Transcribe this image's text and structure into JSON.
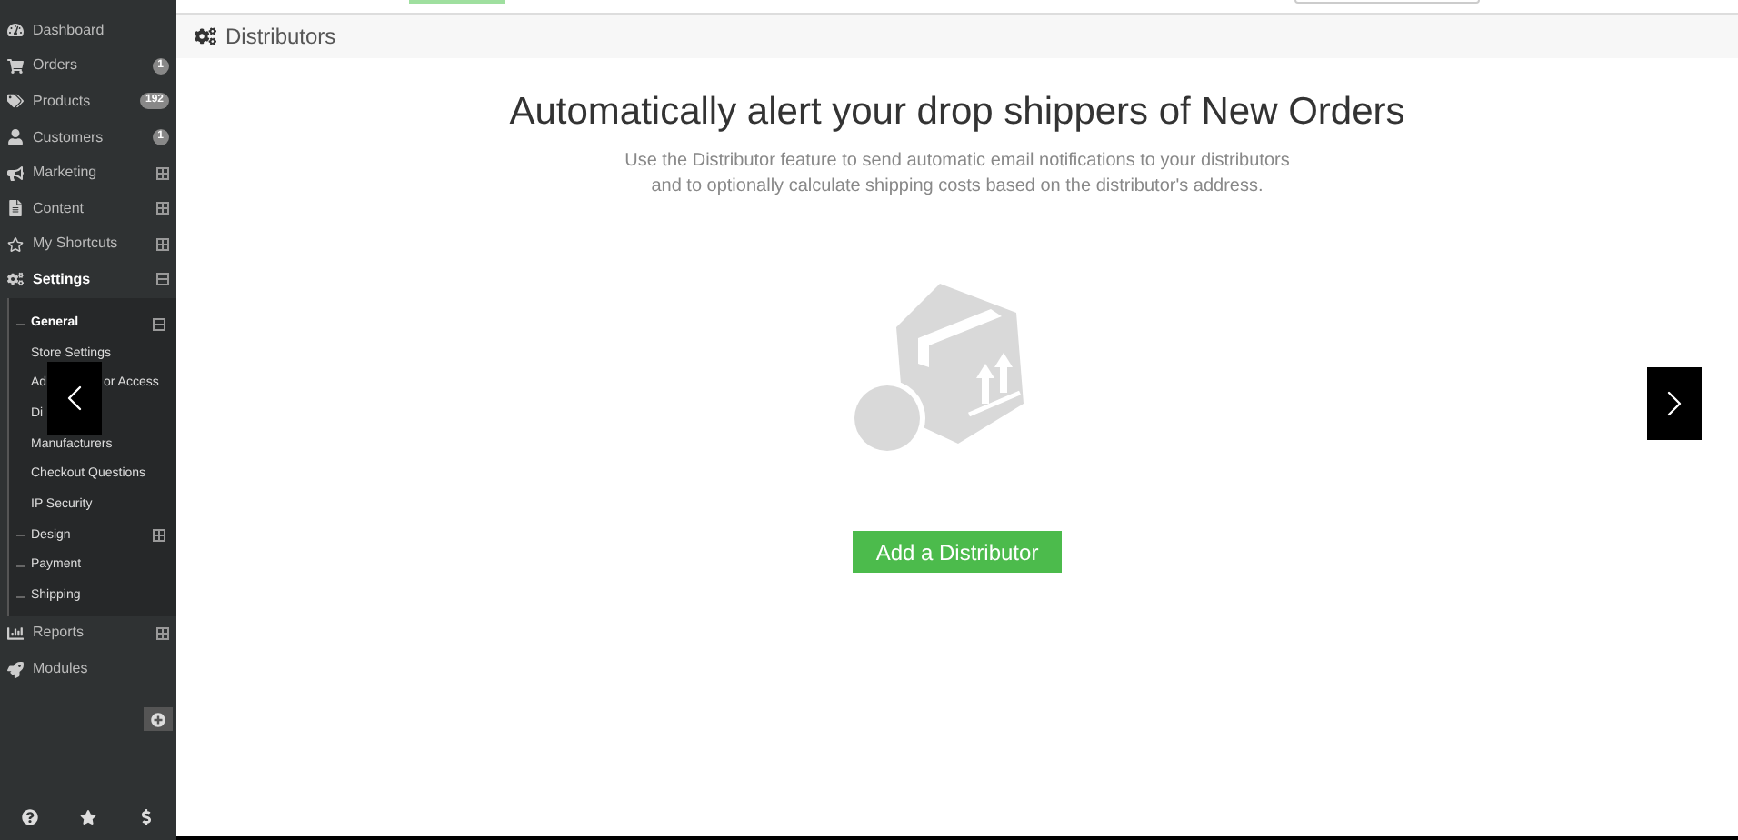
{
  "sidebar": {
    "items": [
      {
        "label": "Dashboard",
        "selected": false
      },
      {
        "label": "Orders",
        "badge": "1",
        "selected": false
      },
      {
        "label": "Products",
        "badge": "192",
        "selected": false
      },
      {
        "label": "Customers",
        "badge": "1",
        "selected": false
      },
      {
        "label": "Marketing",
        "expanded": false,
        "selected": false
      },
      {
        "label": "Content",
        "expanded": false,
        "selected": false
      },
      {
        "label": "My Shortcuts",
        "expanded": false,
        "selected": false
      },
      {
        "label": "Settings",
        "expanded": true,
        "selected": true,
        "children": [
          {
            "kind": "group",
            "label": "General",
            "expanded": true,
            "children": [
              {
                "kind": "link",
                "label": "Store Settings"
              },
              {
                "kind": "link",
                "label": "Ad",
                "label_end": "or Access"
              },
              {
                "kind": "link",
                "label": "Di"
              },
              {
                "kind": "link",
                "label": "Manufacturers"
              },
              {
                "kind": "link",
                "label": "Checkout Questions"
              },
              {
                "kind": "link",
                "label": "IP Security"
              }
            ]
          },
          {
            "kind": "group",
            "label": "Design",
            "expanded": false
          },
          {
            "kind": "group",
            "label": "Payment"
          },
          {
            "kind": "group",
            "label": "Shipping"
          }
        ]
      },
      {
        "label": "Reports",
        "expanded": false,
        "selected": false
      },
      {
        "label": "Modules",
        "selected": false
      }
    ]
  },
  "page": {
    "title": "Distributors",
    "headline": "Automatically alert your drop shippers of New Orders",
    "description": [
      "Use the Distributor feature to send automatic email notifications to your distributors",
      "and to optionally calculate shipping costs based on the distributor's address."
    ],
    "button": "Add a Distributor"
  }
}
